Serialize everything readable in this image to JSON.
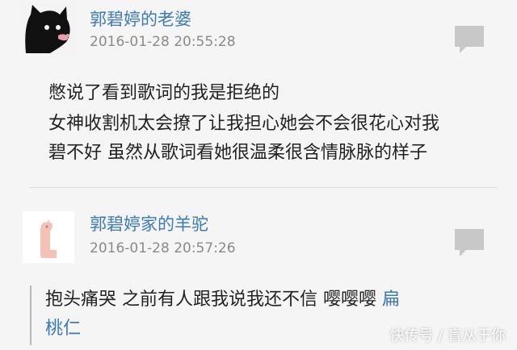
{
  "comments": [
    {
      "username": "郭碧婷的老婆",
      "timestamp": "2016-01-28 20:55:28",
      "lines": [
        "憋说了看到歌词的我是拒绝的",
        "女神收割机太会撩了让我担心她会不会很花心对我",
        "碧不好 虽然从歌词看她很温柔很含情脉脉的样子"
      ]
    },
    {
      "username": "郭碧婷家的羊驼",
      "timestamp": "2016-01-28 20:57:26",
      "text_line1": "抱头痛哭 之前有人跟我说我还不信 嘤嘤嘤 ",
      "link_part1": "扁",
      "link_part2": "桃仁"
    }
  ],
  "watermark": "快传号 / 盲从于你",
  "icons": {
    "avatar1": "black-cat-avatar-icon",
    "avatar2": "alpaca-avatar-icon",
    "reply": "speech-bubble-icon"
  },
  "colors": {
    "username": "#3a7ab8",
    "link": "#3a7ab8",
    "timestamp": "#8a8a8a",
    "background": "#f5f5f5"
  }
}
